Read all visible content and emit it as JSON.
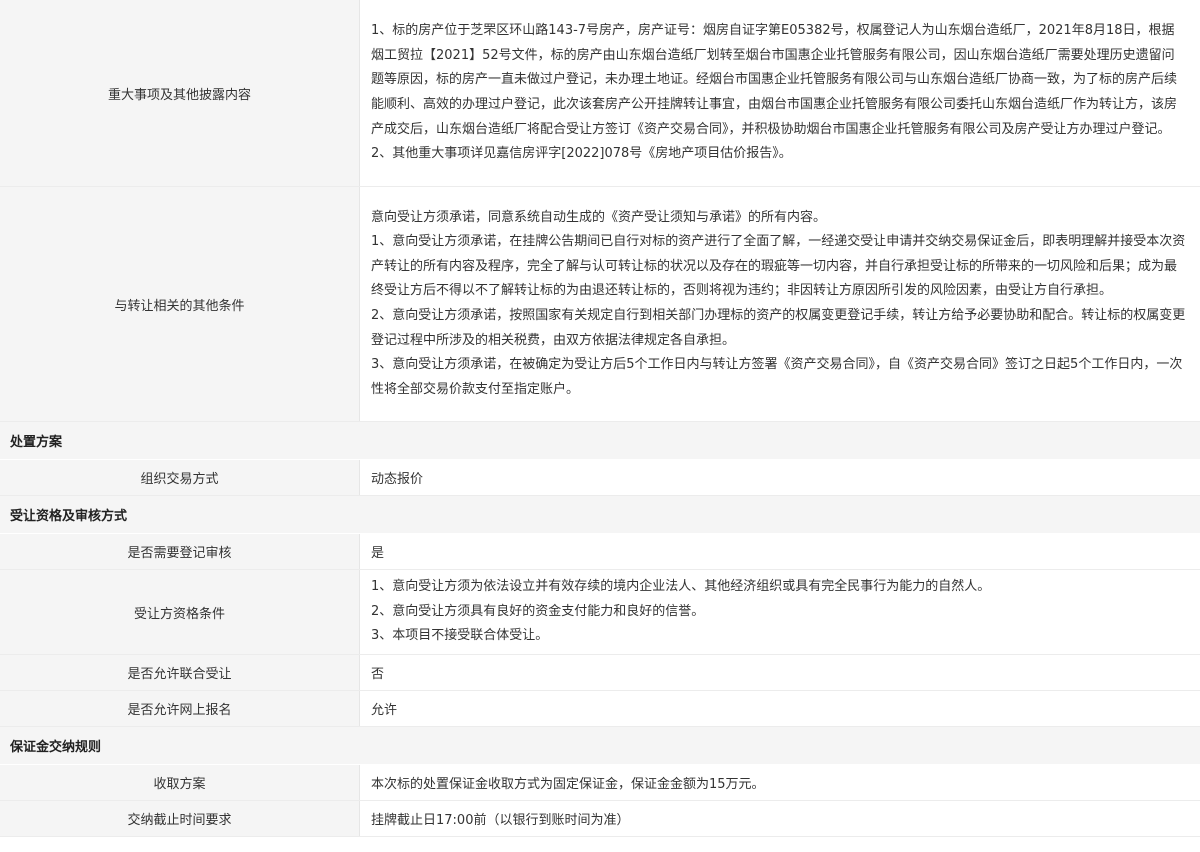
{
  "rows": [
    {
      "label": "重大事项及其他披露内容",
      "paragraphs": [
        "1、标的房产位于芝罘区环山路143-7号房产，房产证号：烟房自证字第E05382号，权属登记人为山东烟台造纸厂，2021年8月18日，根据烟工贸拉【2021】52号文件，标的房产由山东烟台造纸厂划转至烟台市国惠企业托管服务有限公司，因山东烟台造纸厂需要处理历史遗留问题等原因，标的房产一直未做过户登记，未办理土地证。经烟台市国惠企业托管服务有限公司与山东烟台造纸厂协商一致，为了标的房产后续能顺利、高效的办理过户登记，此次该套房产公开挂牌转让事宜，由烟台市国惠企业托管服务有限公司委托山东烟台造纸厂作为转让方，该房产成交后，山东烟台造纸厂将配合受让方签订《资产交易合同》，并积极协助烟台市国惠企业托管服务有限公司及房产受让方办理过户登记。",
        "2、其他重大事项详见嘉信房评字[2022]078号《房地产项目估价报告》。"
      ]
    },
    {
      "label": "与转让相关的其他条件",
      "paragraphs": [
        "意向受让方须承诺，同意系统自动生成的《资产受让须知与承诺》的所有内容。",
        "1、意向受让方须承诺，在挂牌公告期间已自行对标的资产进行了全面了解，一经递交受让申请并交纳交易保证金后，即表明理解并接受本次资产转让的所有内容及程序，完全了解与认可转让标的状况以及存在的瑕疵等一切内容，并自行承担受让标的所带来的一切风险和后果；成为最终受让方后不得以不了解转让标的为由退还转让标的，否则将视为违约；非因转让方原因所引发的风险因素，由受让方自行承担。",
        "2、意向受让方须承诺，按照国家有关规定自行到相关部门办理标的资产的权属变更登记手续，转让方给予必要协助和配合。转让标的权属变更登记过程中所涉及的相关税费，由双方依据法律规定各自承担。",
        "3、意向受让方须承诺，在被确定为受让方后5个工作日内与转让方签署《资产交易合同》，自《资产交易合同》签订之日起5个工作日内，一次性将全部交易价款支付至指定账户。"
      ]
    }
  ],
  "sections": [
    {
      "title": "处置方案",
      "rows": [
        {
          "label": "组织交易方式",
          "value": "动态报价"
        }
      ]
    },
    {
      "title": "受让资格及审核方式",
      "rows": [
        {
          "label": "是否需要登记审核",
          "value": "是"
        },
        {
          "label": "受让方资格条件",
          "paragraphs": [
            "1、意向受让方须为依法设立并有效存续的境内企业法人、其他经济组织或具有完全民事行为能力的自然人。",
            "2、意向受让方须具有良好的资金支付能力和良好的信誉。",
            "3、本项目不接受联合体受让。"
          ]
        },
        {
          "label": "是否允许联合受让",
          "value": "否"
        },
        {
          "label": "是否允许网上报名",
          "value": "允许"
        }
      ]
    },
    {
      "title": "保证金交纳规则",
      "rows": [
        {
          "label": "收取方案",
          "value": "本次标的处置保证金收取方式为固定保证金，保证金金额为15万元。"
        },
        {
          "label": "交纳截止时间要求",
          "value": "挂牌截止日17:00前（以银行到账时间为准）"
        }
      ]
    }
  ]
}
